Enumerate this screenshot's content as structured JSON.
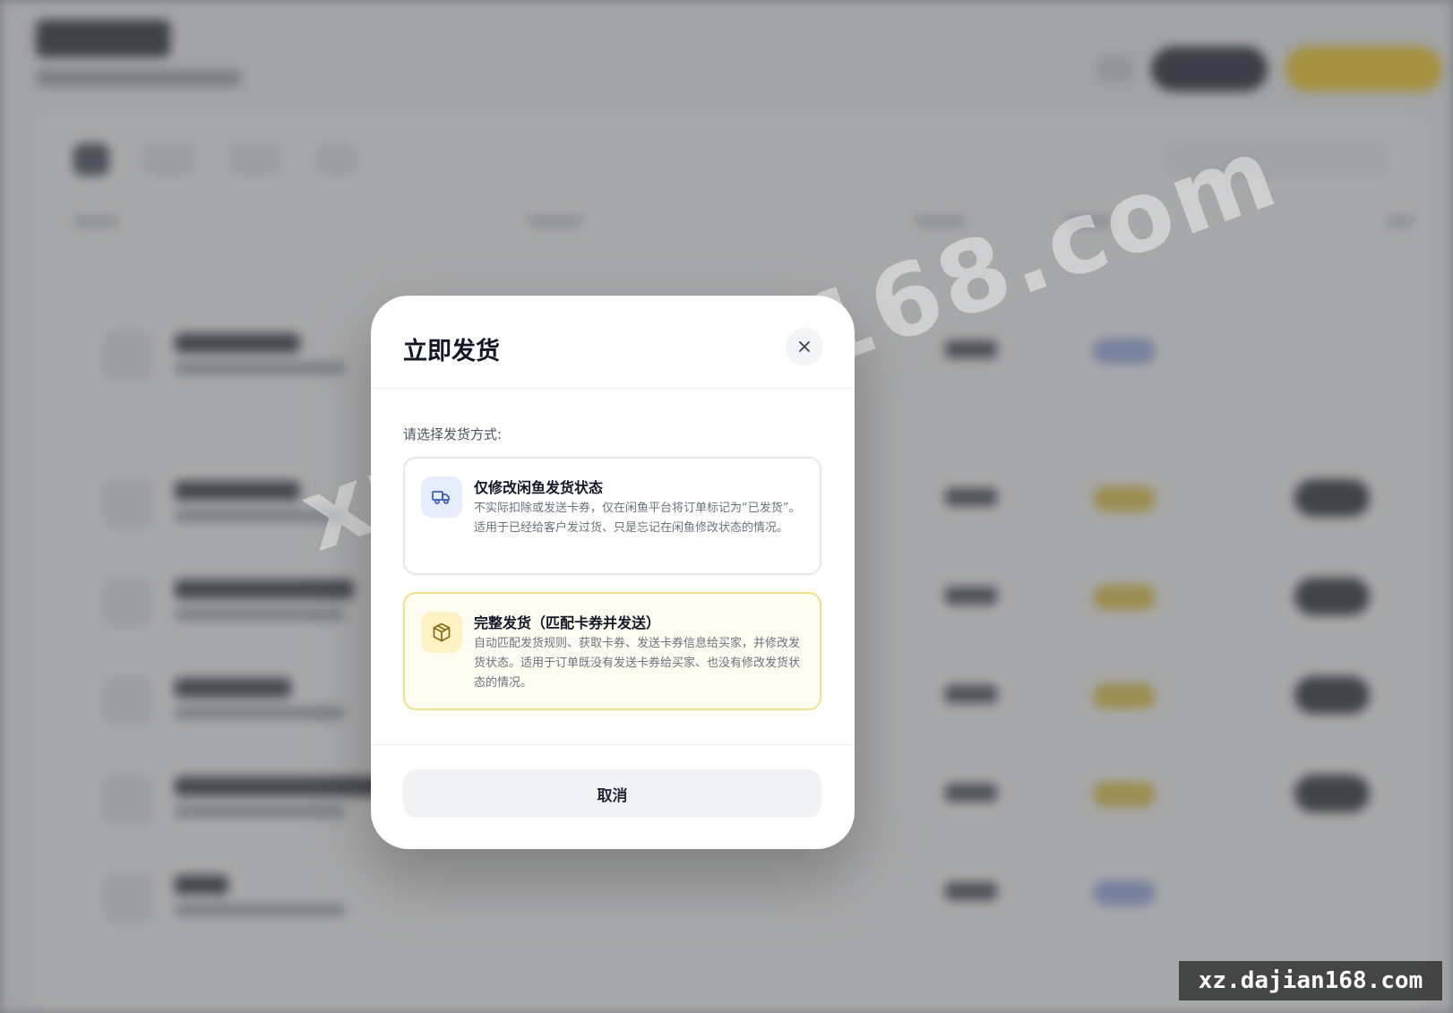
{
  "modal": {
    "title": "立即发货",
    "prompt": "请选择发货方式:",
    "options": [
      {
        "title": "仅修改闲鱼发货状态",
        "description": "不实际扣除或发送卡券，仅在闲鱼平台将订单标记为“已发货”。适用于已经给客户发过货、只是忘记在闲鱼修改状态的情况。",
        "icon": "truck-icon",
        "accent": "#e6edfb"
      },
      {
        "title": "完整发货（匹配卡券并发送）",
        "description": "自动匹配发货规则、获取卡券、发送卡券信息给买家，并修改发货状态。适用于订单既没有发送卡券给买家、也没有修改发货状态的情况。",
        "icon": "package-icon",
        "accent": "#fcf2c4",
        "selected": true
      }
    ],
    "cancel_label": "取消"
  },
  "watermark": {
    "diagonal": "xz.dajian168.com",
    "corner": "xz.dajian168.com"
  },
  "colors": {
    "overlay": "#5f6063",
    "selected_border": "#f4e08a",
    "selected_bg": "#fffdf1",
    "brand_yellow": "#facc15",
    "dark": "#111827"
  }
}
